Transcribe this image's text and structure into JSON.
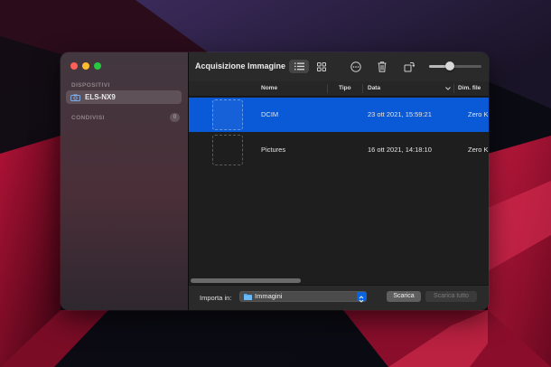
{
  "window": {
    "title": "Acquisizione Immagine"
  },
  "sidebar": {
    "devices_header": "DISPOSITIVI",
    "device": {
      "label": "ELS-NX9",
      "icon": "camera-icon"
    },
    "shared_header": "CONDIVISI",
    "shared_count": "0"
  },
  "toolbar": {
    "list_view_icon": "list-view-icon",
    "grid_view_icon": "grid-view-icon",
    "more_icon": "ellipsis-circle-icon",
    "delete_icon": "trash-icon",
    "rotate_icon": "rotate-icon",
    "thumbnail_size": 0.4
  },
  "table": {
    "columns": [
      "Nome",
      "Tipo",
      "Data",
      "Dim. file"
    ],
    "rows": [
      {
        "name": "DCIM",
        "type": "",
        "date": "23 ott 2021, 15:59:21",
        "size": "Zero K",
        "selected": true
      },
      {
        "name": "Pictures",
        "type": "",
        "date": "16 ott 2021, 14:18:10",
        "size": "Zero K",
        "selected": false
      }
    ]
  },
  "bottom": {
    "import_label": "Importa in:",
    "destination": "Immagini",
    "download_button": "Scarica",
    "download_all_button": "Scarica tutto"
  },
  "colors": {
    "selection": "#0a59d6",
    "traffic_red": "#fe5f57",
    "traffic_yellow": "#febc2e",
    "traffic_green": "#28c840"
  }
}
